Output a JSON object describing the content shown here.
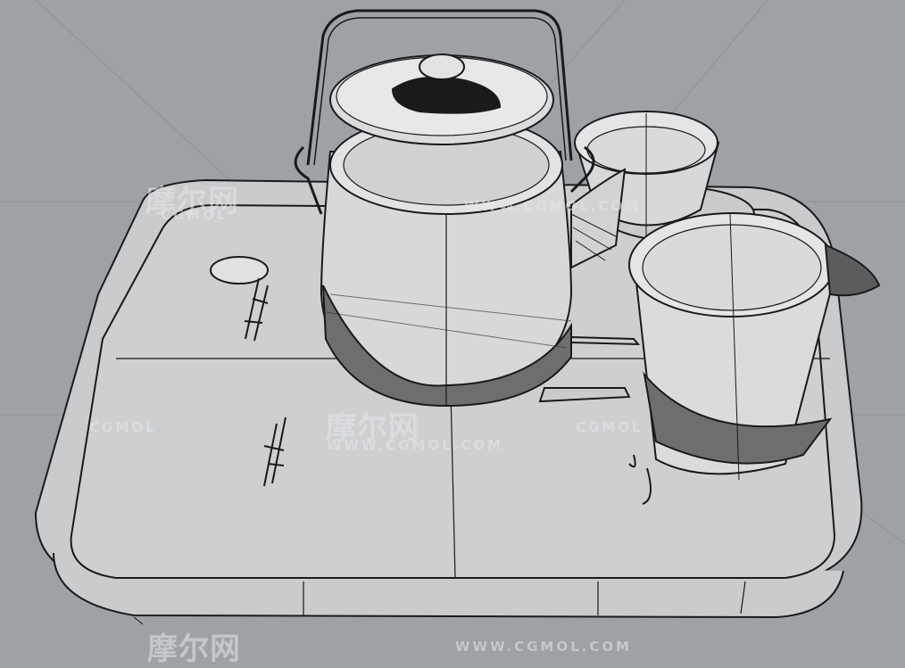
{
  "scene": {
    "subject": "3D wireframe model of a teapot, cups and tray",
    "background_color": "#9ea2a6",
    "surface_color": "#c9cbcd",
    "line_color": "#1a1a1a"
  },
  "watermarks": {
    "cn_1": "摩尔网",
    "en_1": "CGMOL",
    "cn_2": "摩尔网",
    "en_2": "WWW.CGMOL.COM",
    "en_3": "CGMOL",
    "en_4": "CGMOL",
    "cn_3": "摩尔网",
    "en_5": "WWW.CGMOL.COM",
    "en_6": "WWW.CGMOL.COM"
  }
}
